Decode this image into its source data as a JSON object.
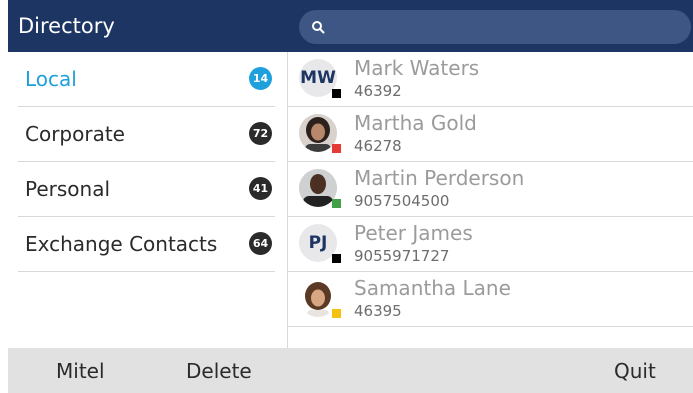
{
  "header": {
    "title": "Directory",
    "search_placeholder": ""
  },
  "menu": [
    {
      "label": "Local",
      "count": "14",
      "active": true
    },
    {
      "label": "Corporate",
      "count": "72",
      "active": false
    },
    {
      "label": "Personal",
      "count": "41",
      "active": false
    },
    {
      "label": "Exchange Contacts",
      "count": "64",
      "active": false
    }
  ],
  "contacts": [
    {
      "name": "Mark Waters",
      "number": "46392",
      "initials": "MW",
      "status_color": "#000000"
    },
    {
      "name": "Martha Gold",
      "number": "46278",
      "initials": "",
      "status_color": "#e53935"
    },
    {
      "name": "Martin Perderson",
      "number": "9057504500",
      "initials": "",
      "status_color": "#43a047"
    },
    {
      "name": "Peter James",
      "number": "9055971727",
      "initials": "PJ",
      "status_color": "#000000"
    },
    {
      "name": "Samantha Lane",
      "number": "46395",
      "initials": "",
      "status_color": "#f4c20d"
    }
  ],
  "softkeys": {
    "left1": "Mitel",
    "left2": "Delete",
    "right": "Quit"
  },
  "colors": {
    "header_bg": "#1d3563",
    "accent": "#1ea0dc",
    "softkey_bg": "#e1e1e1"
  }
}
